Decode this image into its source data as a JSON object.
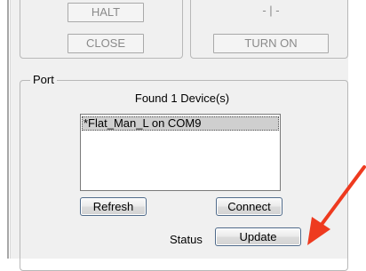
{
  "top_left": {
    "halt_label": "HALT",
    "close_label": "CLOSE"
  },
  "top_right": {
    "light_status": "- | -",
    "turn_on_label": "TURN ON"
  },
  "port": {
    "legend": "Port",
    "found_text": "Found 1 Device(s)",
    "devices": [
      "*Flat_Man_L on COM9"
    ],
    "refresh_label": "Refresh",
    "connect_label": "Connect",
    "status_label": "Status",
    "update_label": "Update"
  },
  "colors": {
    "annotation_arrow": "#ee3a1f",
    "panel_bg": "#f0f0f0"
  }
}
